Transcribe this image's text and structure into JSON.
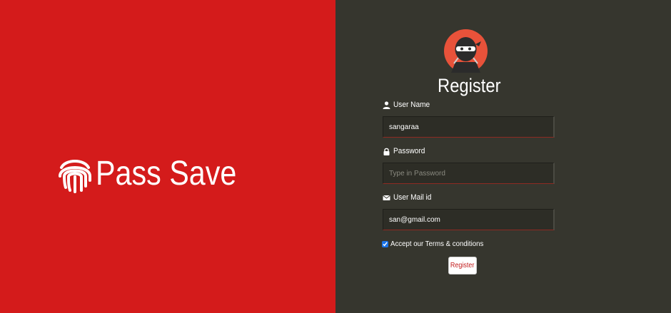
{
  "brand": {
    "name": "Pass Save",
    "logo_icon": "fingerprint-icon"
  },
  "register": {
    "avatar_icon": "ninja-avatar-icon",
    "title": "Register",
    "fields": {
      "username": {
        "label": "User Name",
        "icon": "user-icon",
        "value": "sangaraa",
        "placeholder": ""
      },
      "password": {
        "label": "Password",
        "icon": "lock-icon",
        "value": "",
        "placeholder": "Type in Password"
      },
      "email": {
        "label": "User Mail id",
        "icon": "envelope-icon",
        "value": "san@gmail.com",
        "placeholder": ""
      }
    },
    "terms": {
      "label": "Accept our Terms & conditions",
      "checked": true
    },
    "submit_label": "Register"
  },
  "colors": {
    "left_background": "#d41b1b",
    "right_background": "#36362e",
    "avatar_ring": "#e8523a",
    "button_text": "#c21c1c"
  }
}
